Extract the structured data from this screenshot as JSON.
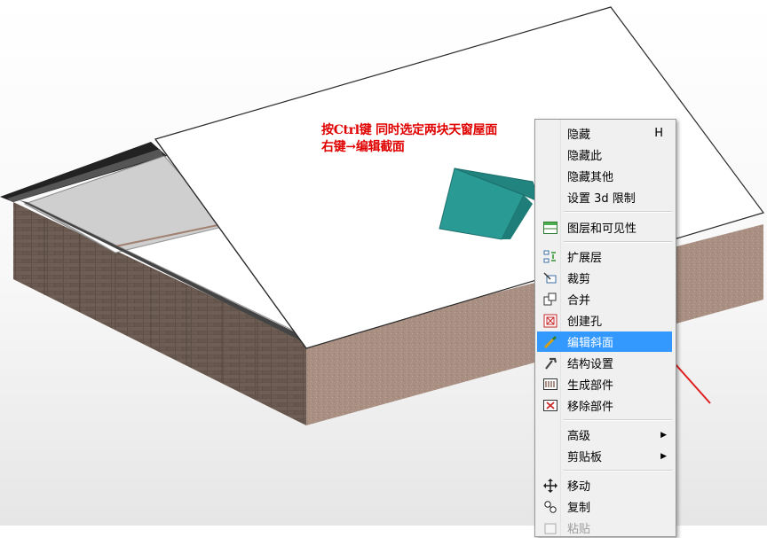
{
  "annotation": {
    "line1": "按Ctrl键 同时选定两块天窗屋面",
    "line2": "右键→编辑截面",
    "color": "#e00000"
  },
  "context_menu": {
    "items": [
      {
        "label": "隐藏",
        "shortcut": "H",
        "icon": "none"
      },
      {
        "label": "隐藏此",
        "icon": "none"
      },
      {
        "label": "隐藏其他",
        "icon": "none"
      },
      {
        "label": "设置 3d 限制",
        "icon": "none"
      },
      {
        "label": "图层和可见性",
        "icon": "layers-icon"
      },
      {
        "label": "扩展层",
        "icon": "extend-layer-icon"
      },
      {
        "label": "裁剪",
        "icon": "trim-icon"
      },
      {
        "label": "合并",
        "icon": "merge-icon"
      },
      {
        "label": "创建孔",
        "icon": "create-hole-icon"
      },
      {
        "label": "编辑斜面",
        "icon": "edit-slope-icon",
        "highlighted": true
      },
      {
        "label": "结构设置",
        "icon": "structure-settings-icon"
      },
      {
        "label": "生成部件",
        "icon": "create-component-icon"
      },
      {
        "label": "移除部件",
        "icon": "remove-component-icon"
      },
      {
        "label": "高级",
        "submenu": true,
        "icon": "none"
      },
      {
        "label": "剪贴板",
        "submenu": true,
        "icon": "none"
      },
      {
        "label": "移动",
        "icon": "move-icon"
      },
      {
        "label": "复制",
        "icon": "copy-icon"
      },
      {
        "label": "粘贴",
        "icon": "paste-icon",
        "disabled": true
      }
    ],
    "highlight_color": "#3399ff"
  },
  "arrow_color": "#e02020"
}
